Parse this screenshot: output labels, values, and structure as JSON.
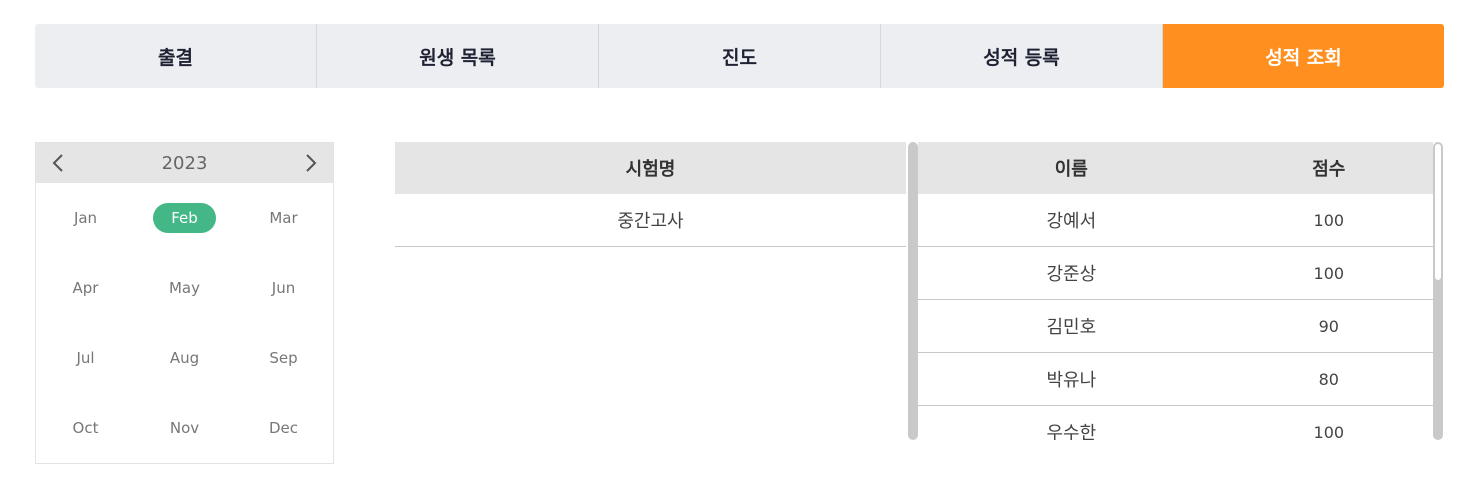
{
  "tabs": [
    {
      "label": "출결"
    },
    {
      "label": "원생 목록"
    },
    {
      "label": "진도"
    },
    {
      "label": "성적 등록"
    },
    {
      "label": "성적 조회"
    }
  ],
  "colors": {
    "active_tab": "#ff8f1f",
    "selected_month": "#43b886"
  },
  "calendar": {
    "year": "2023",
    "months": [
      "Jan",
      "Feb",
      "Mar",
      "Apr",
      "May",
      "Jun",
      "Jul",
      "Aug",
      "Sep",
      "Oct",
      "Nov",
      "Dec"
    ],
    "selected": "Feb"
  },
  "exam_table": {
    "header": "시험명",
    "rows": [
      "중간고사"
    ]
  },
  "score_table": {
    "headers": {
      "name": "이름",
      "score": "점수"
    },
    "rows": [
      {
        "name": "강예서",
        "score": "100"
      },
      {
        "name": "강준상",
        "score": "100"
      },
      {
        "name": "김민호",
        "score": "90"
      },
      {
        "name": "박유나",
        "score": "80"
      },
      {
        "name": "우수한",
        "score": "100"
      }
    ]
  }
}
